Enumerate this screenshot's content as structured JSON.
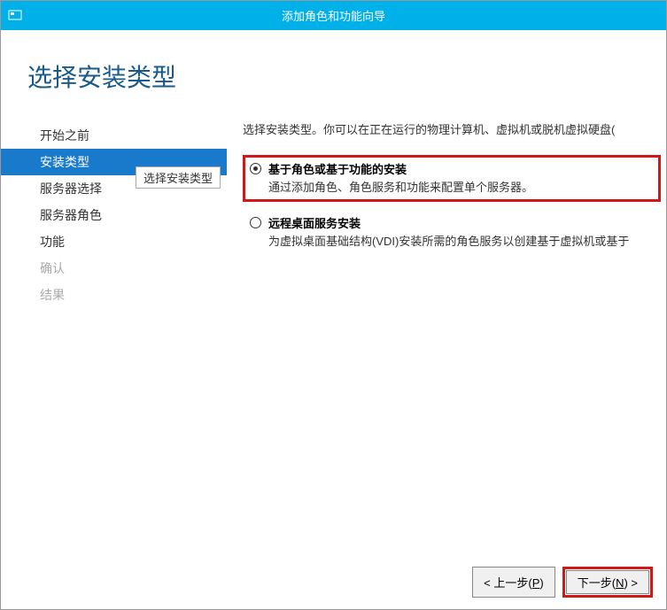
{
  "titlebar": {
    "title": "添加角色和功能向导"
  },
  "page": {
    "title": "选择安装类型"
  },
  "sidebar": {
    "items": [
      {
        "label": "开始之前",
        "state": "enabled"
      },
      {
        "label": "安装类型",
        "state": "active"
      },
      {
        "label": "服务器选择",
        "state": "enabled"
      },
      {
        "label": "服务器角色",
        "state": "enabled"
      },
      {
        "label": "功能",
        "state": "enabled"
      },
      {
        "label": "确认",
        "state": "disabled"
      },
      {
        "label": "结果",
        "state": "disabled"
      }
    ],
    "tooltip": "选择安装类型"
  },
  "main": {
    "prompt": "选择安装类型。你可以在正在运行的物理计算机、虚拟机或脱机虚拟硬盘(",
    "options": [
      {
        "title": "基于角色或基于功能的安装",
        "desc": "通过添加角色、角色服务和功能来配置单个服务器。",
        "selected": true,
        "highlighted": true
      },
      {
        "title": "远程桌面服务安装",
        "desc": "为虚拟桌面基础结构(VDI)安装所需的角色服务以创建基于虚拟机或基于",
        "selected": false,
        "highlighted": false
      }
    ]
  },
  "footer": {
    "prev": {
      "label": "< 上一步(",
      "accel": "P",
      "tail": ")"
    },
    "next": {
      "label": "下一步(",
      "accel": "N",
      "tail": ") >"
    }
  }
}
